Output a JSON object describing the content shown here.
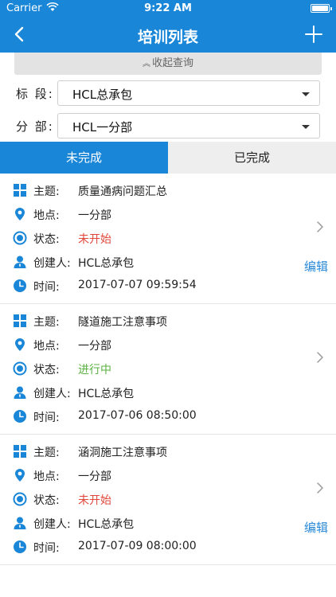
{
  "status_bar": {
    "carrier": "Carrier",
    "time": "9:22 AM"
  },
  "nav": {
    "title": "培训列表"
  },
  "filter": {
    "collapse_label": "收起查询",
    "section_label": "标 段:",
    "section_value": "HCL总承包",
    "branch_label": "分 部:",
    "branch_value": "HCL一分部"
  },
  "tabs": {
    "incomplete": "未完成",
    "complete": "已完成"
  },
  "fields": {
    "topic": "主题:",
    "location": "地点:",
    "status": "状态:",
    "creator": "创建人:",
    "time": "时间:"
  },
  "items": [
    {
      "topic": "质量通病问题汇总",
      "location": "一分部",
      "status": "未开始",
      "creator": "HCL总承包",
      "time": "2017-07-07   09:59:54",
      "edit": "编辑"
    },
    {
      "topic": "隧道施工注意事项",
      "location": "一分部",
      "status": "进行中",
      "creator": "HCL总承包",
      "time": "2017-07-06   08:50:00"
    },
    {
      "topic": "涵洞施工注意事项",
      "location": "一分部",
      "status": "未开始",
      "creator": "HCL总承包",
      "time": "2017-07-09   08:00:00",
      "edit": "编辑"
    }
  ],
  "colors": {
    "primary": "#1a86d8",
    "not_started": "#e2463a",
    "in_progress": "#5ab240",
    "edit_link": "#2a8ad9"
  },
  "icons": {
    "topic": "grid-icon",
    "location": "location-pin-icon",
    "status": "status-ring-icon",
    "creator": "user-icon",
    "time": "clock-icon",
    "row": "chevron-right-icon",
    "back": "chevron-left-icon",
    "add": "plus-icon"
  }
}
